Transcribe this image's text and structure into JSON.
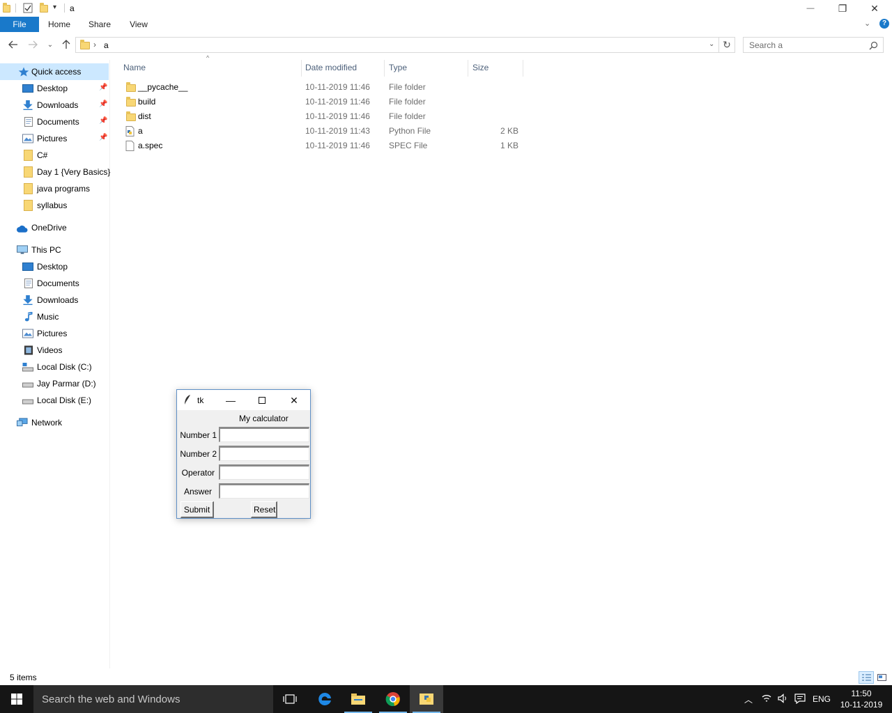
{
  "window": {
    "title": "a",
    "minimize": "—",
    "restore": "❐",
    "close": "✕"
  },
  "ribbon": {
    "tabs": [
      "File",
      "Home",
      "Share",
      "View"
    ]
  },
  "address": {
    "path_separator": "›",
    "path": "a",
    "search_placeholder": "Search a"
  },
  "nav": {
    "quick_access": "Quick access",
    "quick_items": [
      {
        "label": "Desktop",
        "pinned": true
      },
      {
        "label": "Downloads",
        "pinned": true
      },
      {
        "label": "Documents",
        "pinned": true
      },
      {
        "label": "Pictures",
        "pinned": true
      },
      {
        "label": "C#",
        "pinned": false
      },
      {
        "label": "Day 1 {Very Basics}",
        "pinned": false
      },
      {
        "label": "java programs",
        "pinned": false
      },
      {
        "label": "syllabus",
        "pinned": false
      }
    ],
    "onedrive": "OneDrive",
    "this_pc": "This PC",
    "pc_items": [
      "Desktop",
      "Documents",
      "Downloads",
      "Music",
      "Pictures",
      "Videos",
      "Local Disk (C:)",
      "Jay Parmar (D:)",
      "Local Disk (E:)"
    ],
    "network": "Network"
  },
  "files": {
    "columns": [
      "Name",
      "Date modified",
      "Type",
      "Size"
    ],
    "rows": [
      {
        "name": "__pycache__",
        "date": "10-11-2019 11:46",
        "type": "File folder",
        "size": "",
        "icon": "folder-icon"
      },
      {
        "name": "build",
        "date": "10-11-2019 11:46",
        "type": "File folder",
        "size": "",
        "icon": "folder-icon"
      },
      {
        "name": "dist",
        "date": "10-11-2019 11:46",
        "type": "File folder",
        "size": "",
        "icon": "folder-icon"
      },
      {
        "name": "a",
        "date": "10-11-2019 11:43",
        "type": "Python File",
        "size": "2 KB",
        "icon": "python-file-icon"
      },
      {
        "name": "a.spec",
        "date": "10-11-2019 11:46",
        "type": "SPEC File",
        "size": "1 KB",
        "icon": "file-icon"
      }
    ]
  },
  "status": {
    "count": "5 items"
  },
  "tk": {
    "title": "tk",
    "heading": "My calculator",
    "labels": [
      "Number 1",
      "Number 2",
      "Operator",
      "Answer"
    ],
    "values": [
      "",
      "",
      "",
      ""
    ],
    "submit": "Submit",
    "reset": "Reset"
  },
  "taskbar": {
    "search": "Search the web and Windows",
    "lang": "ENG",
    "time": "11:50",
    "date": "10-11-2019"
  },
  "colors": {
    "accent": "#1979ca",
    "folder": "#f8d775",
    "taskbar": "#151515"
  }
}
